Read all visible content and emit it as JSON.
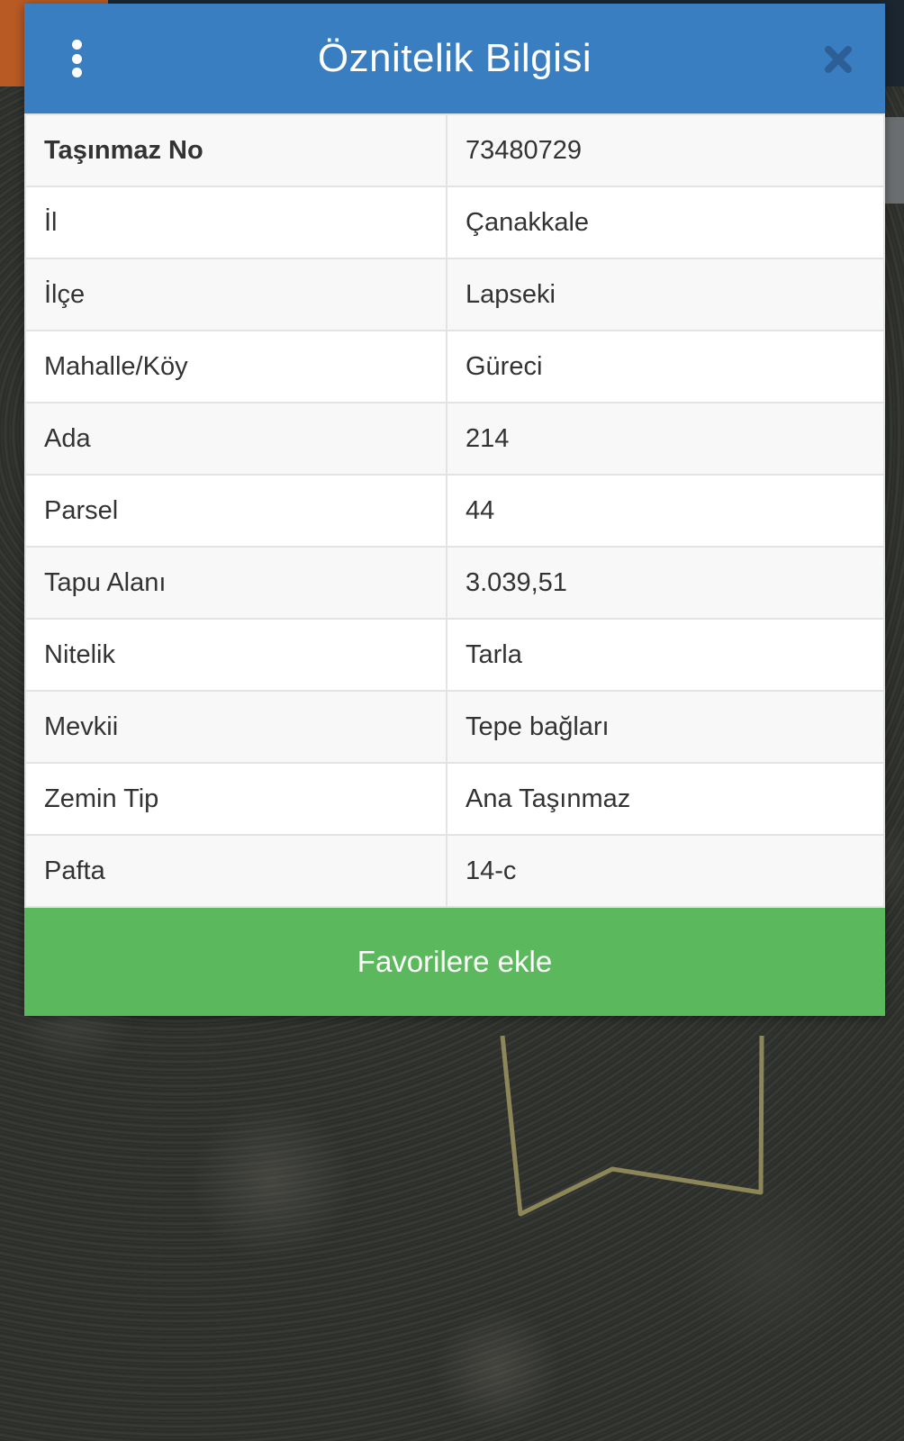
{
  "dialog": {
    "title": "Öznitelik Bilgisi",
    "menu_icon": "vertical-dots-icon",
    "close_icon": "close-x-icon",
    "colors": {
      "header": "#3a7ec2",
      "button": "#5cb85c",
      "close": "#2b5f95"
    }
  },
  "attributes": [
    {
      "key": "Taşınmaz No",
      "value": "73480729"
    },
    {
      "key": "İl",
      "value": "Çanakkale"
    },
    {
      "key": "İlçe",
      "value": "Lapseki"
    },
    {
      "key": "Mahalle/Köy",
      "value": "Güreci"
    },
    {
      "key": "Ada",
      "value": "214"
    },
    {
      "key": "Parsel",
      "value": "44"
    },
    {
      "key": "Tapu Alanı",
      "value": "3.039,51"
    },
    {
      "key": "Nitelik",
      "value": "Tarla"
    },
    {
      "key": "Mevkii",
      "value": "Tepe bağları"
    },
    {
      "key": "Zemin Tip",
      "value": "Ana Taşınmaz"
    },
    {
      "key": "Pafta",
      "value": "14-c"
    }
  ],
  "actions": {
    "favorite_label": "Favorilere ekle"
  }
}
